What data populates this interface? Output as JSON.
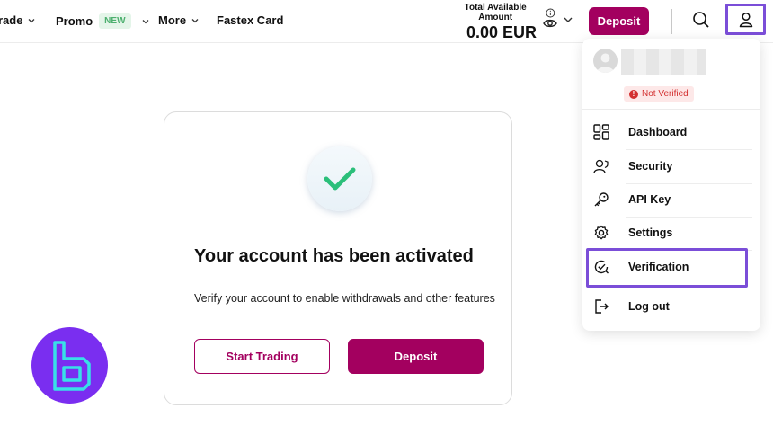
{
  "nav": {
    "trade_label": "rade",
    "promo_label": "Promo",
    "promo_badge": "NEW",
    "more_label": "More",
    "fastex_label": "Fastex Card"
  },
  "balance": {
    "label": "Total Available Amount",
    "value": "0.00 EUR"
  },
  "header": {
    "deposit_label": "Deposit"
  },
  "card": {
    "title": "Your account has been activated",
    "subtitle": "Verify your account to enable withdrawals and other features",
    "start_trading_label": "Start Trading",
    "deposit_label": "Deposit"
  },
  "dropdown": {
    "status": "Not Verified",
    "status_icon": "!",
    "items": [
      {
        "label": "Dashboard",
        "icon": "dashboard-icon"
      },
      {
        "label": "Security",
        "icon": "security-icon"
      },
      {
        "label": "API Key",
        "icon": "key-icon"
      },
      {
        "label": "Settings",
        "icon": "gear-icon"
      },
      {
        "label": "Verification",
        "icon": "verification-icon"
      },
      {
        "label": "Log out",
        "icon": "logout-icon"
      }
    ]
  },
  "colors": {
    "brand": "#a3005f",
    "highlight": "#7b4ed8",
    "logo_bg": "#7a2ef0",
    "check": "#2bbf7a",
    "error": "#d32f2f"
  }
}
